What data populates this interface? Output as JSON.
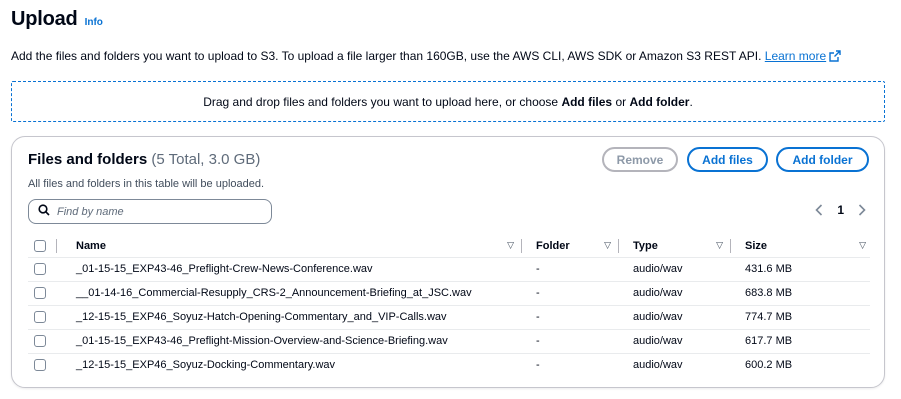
{
  "header": {
    "title": "Upload",
    "info": "Info"
  },
  "description": {
    "text": "Add the files and folders you want to upload to S3. To upload a file larger than 160GB, use the AWS CLI, AWS SDK or Amazon S3 REST API.",
    "learn_more": "Learn more",
    "link_icon": "external-link-icon"
  },
  "dropzone": {
    "prefix": "Drag and drop files and folders you want to upload here, or choose ",
    "add_files": "Add files",
    "or": " or ",
    "add_folder": "Add folder",
    "suffix": "."
  },
  "files_panel": {
    "title": "Files and folders",
    "count": "(5 Total, 3.0 GB)",
    "subtitle": "All files and folders in this table will be uploaded.",
    "buttons": {
      "remove": "Remove",
      "add_files": "Add files",
      "add_folder": "Add folder"
    },
    "search": {
      "placeholder": "Find by name",
      "icon": "search-icon"
    },
    "pagination": {
      "current_page": "1",
      "prev_icon": "chevron-left-icon",
      "next_icon": "chevron-right-icon"
    },
    "columns": [
      "Name",
      "Folder",
      "Type",
      "Size"
    ],
    "rows": [
      {
        "name": "_01-15-15_EXP43-46_Preflight-Crew-News-Conference.wav",
        "folder": "-",
        "type": "audio/wav",
        "size": "431.6 MB"
      },
      {
        "name": "__01-14-16_Commercial-Resupply_CRS-2_Announcement-Briefing_at_JSC.wav",
        "folder": "-",
        "type": "audio/wav",
        "size": "683.8 MB"
      },
      {
        "name": "_12-15-15_EXP46_Soyuz-Hatch-Opening-Commentary_and_VIP-Calls.wav",
        "folder": "-",
        "type": "audio/wav",
        "size": "774.7 MB"
      },
      {
        "name": "_01-15-15_EXP43-46_Preflight-Mission-Overview-and-Science-Briefing.wav",
        "folder": "-",
        "type": "audio/wav",
        "size": "617.7 MB"
      },
      {
        "name": "_12-15-15_EXP46_Soyuz-Docking-Commentary.wav",
        "folder": "-",
        "type": "audio/wav",
        "size": "600.2 MB"
      }
    ]
  },
  "colors": {
    "link": "#0972d3",
    "text": "#000716",
    "disabled": "#8d99a8"
  }
}
